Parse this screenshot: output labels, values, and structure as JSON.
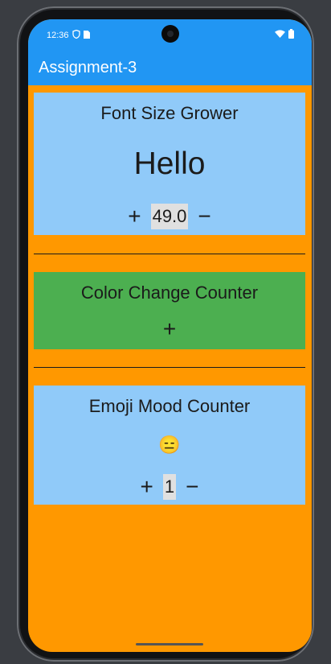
{
  "status": {
    "time": "12:36"
  },
  "appbar": {
    "title": "Assignment-3"
  },
  "font_card": {
    "title": "Font Size Grower",
    "text": "Hello",
    "plus": "+",
    "value": "49.0",
    "minus": "−"
  },
  "color_card": {
    "title": "Color Change Counter",
    "plus": "+"
  },
  "emoji_card": {
    "title": "Emoji Mood Counter",
    "emoji": "😑",
    "plus": "+",
    "value": "1",
    "minus": "−"
  },
  "colors": {
    "appbar": "#2196f3",
    "background": "#ff9800",
    "card_blue": "#90caf9",
    "card_green": "#4caf50"
  },
  "icons": [
    "shield-icon",
    "sim-icon",
    "wifi-icon",
    "battery-icon"
  ]
}
